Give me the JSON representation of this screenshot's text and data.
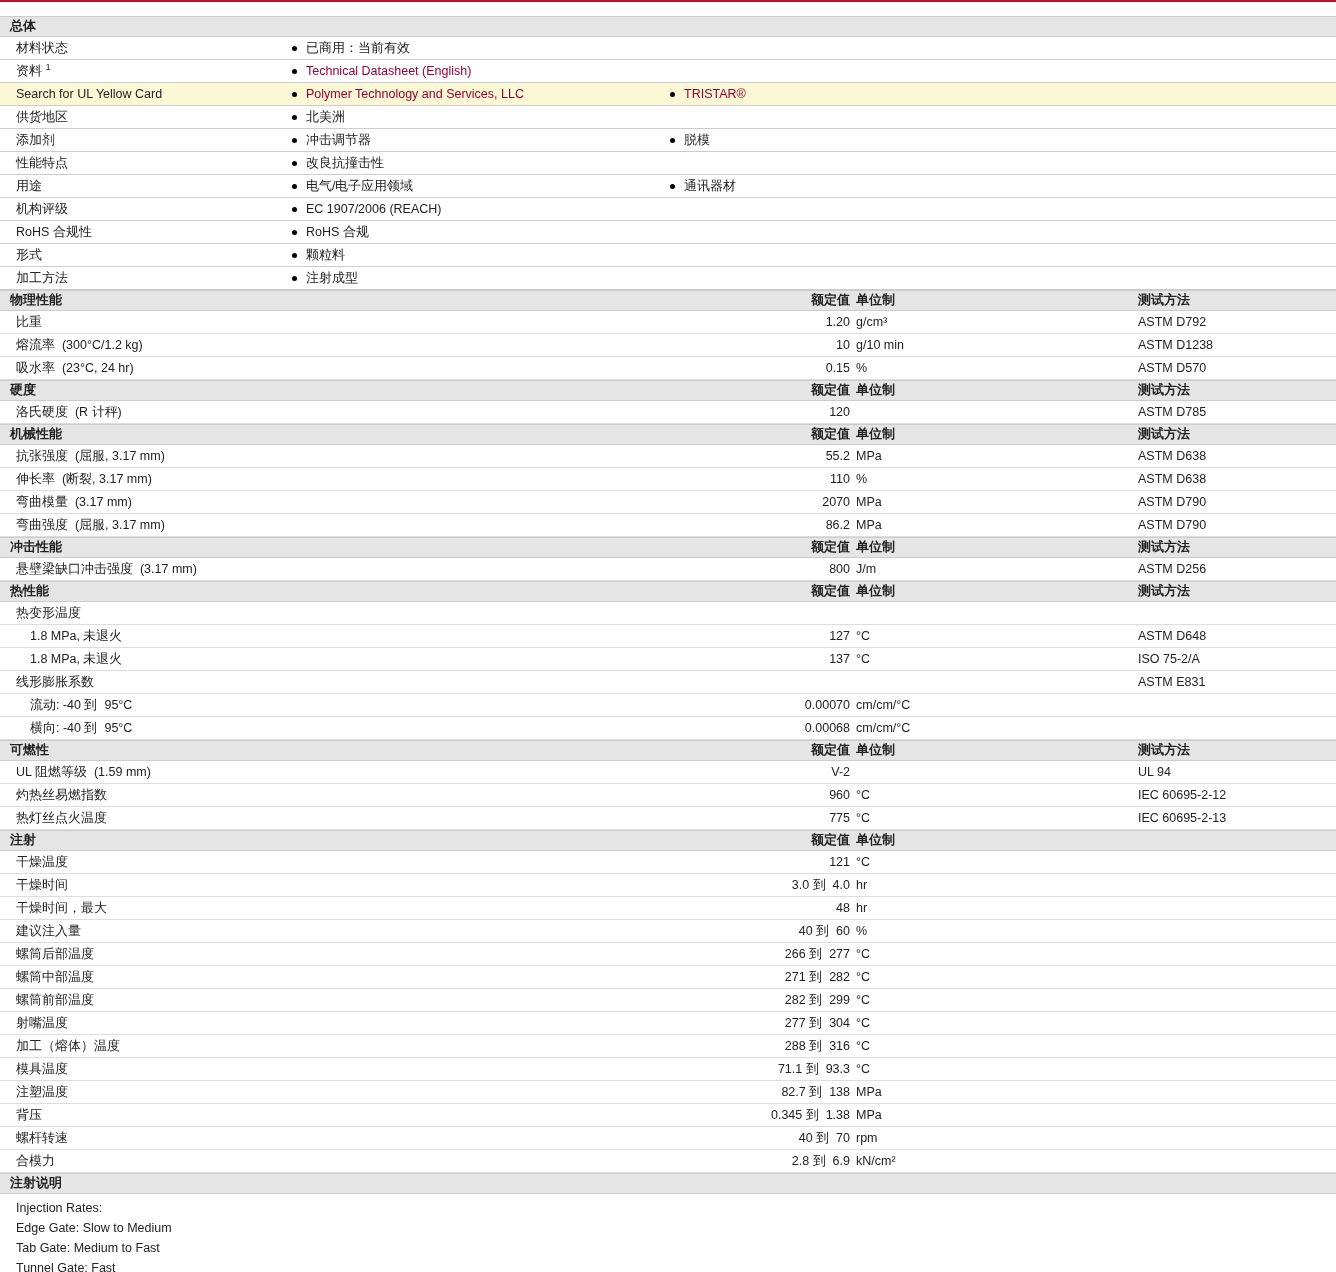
{
  "general": {
    "title": "总体",
    "rows": [
      {
        "label": "材料状态",
        "highlighted": false,
        "items": [
          {
            "text": "已商用：当前有效",
            "link": false
          }
        ]
      },
      {
        "label": "资料 $^{1}$",
        "highlighted": false,
        "items": [
          {
            "text": "Technical Datasheet (English)",
            "link": true
          }
        ]
      },
      {
        "label": "Search for UL Yellow Card",
        "highlighted": true,
        "items": [
          {
            "text": "Polymer Technology and Services, LLC",
            "link": true
          },
          {
            "text": "TRISTAR®",
            "link": true
          }
        ]
      },
      {
        "label": "供货地区",
        "highlighted": false,
        "items": [
          {
            "text": "北美洲",
            "link": false
          }
        ]
      },
      {
        "label": "添加剂",
        "highlighted": false,
        "items": [
          {
            "text": "冲击调节器",
            "link": false
          },
          {
            "text": "脱模",
            "link": false
          }
        ]
      },
      {
        "label": "性能特点",
        "highlighted": false,
        "items": [
          {
            "text": "改良抗撞击性",
            "link": false
          }
        ]
      },
      {
        "label": "用途",
        "highlighted": false,
        "items": [
          {
            "text": "电气/电子应用领域",
            "link": false
          },
          {
            "text": "通讯器材",
            "link": false
          }
        ]
      },
      {
        "label": "机构评级",
        "highlighted": false,
        "items": [
          {
            "text": "EC 1907/2006 (REACH)",
            "link": false
          }
        ]
      },
      {
        "label": "RoHS 合规性",
        "highlighted": false,
        "items": [
          {
            "text": "RoHS 合规",
            "link": false
          }
        ]
      },
      {
        "label": "形式",
        "highlighted": false,
        "items": [
          {
            "text": "颗粒料",
            "link": false
          }
        ]
      },
      {
        "label": "加工方法",
        "highlighted": false,
        "items": [
          {
            "text": "注射成型",
            "link": false
          }
        ]
      }
    ]
  },
  "sections": [
    {
      "title": "物理性能",
      "value_header": "额定值",
      "unit_header": "单位制",
      "method_header": "测试方法",
      "rows": [
        {
          "label": "比重",
          "value": "1.20",
          "unit": "g/cm³",
          "method": "ASTM D792"
        },
        {
          "label": "熔流率  (300°C/1.2 kg)",
          "value": "10",
          "unit": "g/10 min",
          "method": "ASTM D1238"
        },
        {
          "label": "吸水率  (23°C, 24 hr)",
          "value": "0.15",
          "unit": "%",
          "method": "ASTM D570"
        }
      ]
    },
    {
      "title": "硬度",
      "value_header": "额定值",
      "unit_header": "单位制",
      "method_header": "测试方法",
      "rows": [
        {
          "label": "洛氏硬度  (R 计秤)",
          "value": "120",
          "method": "ASTM D785"
        }
      ]
    },
    {
      "title": "机械性能",
      "value_header": "额定值",
      "unit_header": "单位制",
      "method_header": "测试方法",
      "rows": [
        {
          "label": "抗张强度  (屈服, 3.17 mm)",
          "value": "55.2",
          "unit": "MPa",
          "method": "ASTM D638"
        },
        {
          "label": "伸长率  (断裂, 3.17 mm)",
          "value": "110",
          "unit": "%",
          "method": "ASTM D638"
        },
        {
          "label": "弯曲模量  (3.17 mm)",
          "value": "2070",
          "unit": "MPa",
          "method": "ASTM D790"
        },
        {
          "label": "弯曲强度  (屈服, 3.17 mm)",
          "value": "86.2",
          "unit": "MPa",
          "method": "ASTM D790"
        }
      ]
    },
    {
      "title": "冲击性能",
      "value_header": "额定值",
      "unit_header": "单位制",
      "method_header": "测试方法",
      "rows": [
        {
          "label": "悬壁梁缺口冲击强度  (3.17 mm)",
          "value": "800",
          "unit": "J/m",
          "method": "ASTM D256"
        }
      ]
    },
    {
      "title": "热性能",
      "value_header": "额定值",
      "unit_header": "单位制",
      "method_header": "测试方法",
      "rows": [
        {
          "label": "热变形温度",
          "children": [
            {
              "label": "1.8 MPa, 未退火",
              "value": "127",
              "unit": "°C",
              "method": "ASTM D648"
            },
            {
              "label": "1.8 MPa, 未退火",
              "value": "137",
              "unit": "°C",
              "method": "ISO 75-2/A"
            }
          ]
        },
        {
          "label": "线形膨胀系数",
          "method": "ASTM E831",
          "children": [
            {
              "label": "流动: -40 到  95°C",
              "value": "0.00070",
              "unit": "cm/cm/°C"
            },
            {
              "label": "横向: -40 到  95°C",
              "value": "0.00068",
              "unit": "cm/cm/°C"
            }
          ]
        }
      ]
    },
    {
      "title": "可燃性",
      "value_header": "额定值",
      "unit_header": "单位制",
      "method_header": "测试方法",
      "rows": [
        {
          "label": "UL 阻燃等级  (1.59 mm)",
          "value": "V-2",
          "method": "UL 94"
        },
        {
          "label": "灼热丝易燃指数",
          "value": "960",
          "unit": "°C",
          "method": "IEC 60695-2-12"
        },
        {
          "label": "热灯丝点火温度",
          "value": "775",
          "unit": "°C",
          "method": "IEC 60695-2-13"
        }
      ]
    },
    {
      "title": "注射",
      "value_header": "额定值",
      "unit_header": "单位制",
      "rows": [
        {
          "label": "干燥温度",
          "value": "121",
          "unit": "°C"
        },
        {
          "label": "干燥时间",
          "value": "3.0 到  4.0",
          "unit": "hr"
        },
        {
          "label": "干燥时间，最大",
          "value": "48",
          "unit": "hr"
        },
        {
          "label": "建议注入量",
          "value": "40 到  60",
          "unit": "%"
        },
        {
          "label": "螺筒后部温度",
          "value": "266 到  277",
          "unit": "°C"
        },
        {
          "label": "螺筒中部温度",
          "value": "271 到  282",
          "unit": "°C"
        },
        {
          "label": "螺筒前部温度",
          "value": "282 到  299",
          "unit": "°C"
        },
        {
          "label": "射嘴温度",
          "value": "277 到  304",
          "unit": "°C"
        },
        {
          "label": "加工（熔体）温度",
          "value": "288 到  316",
          "unit": "°C"
        },
        {
          "label": "模具温度",
          "value": "71.1 到  93.3",
          "unit": "°C"
        },
        {
          "label": "注塑温度",
          "value": "82.7 到  138",
          "unit": "MPa"
        },
        {
          "label": "背压",
          "value": "0.345 到  1.38",
          "unit": "MPa"
        },
        {
          "label": "螺杆转速",
          "value": "40 到  70",
          "unit": "rpm"
        },
        {
          "label": "合模力",
          "value": "2.8 到  6.9",
          "unit": "kN/cm²"
        }
      ]
    }
  ],
  "notes": {
    "title": "注射说明",
    "lines": [
      "Injection Rates:",
      "Edge Gate: Slow to Medium",
      "Tab Gate: Medium to Fast",
      "Tunnel Gate: Fast"
    ]
  }
}
